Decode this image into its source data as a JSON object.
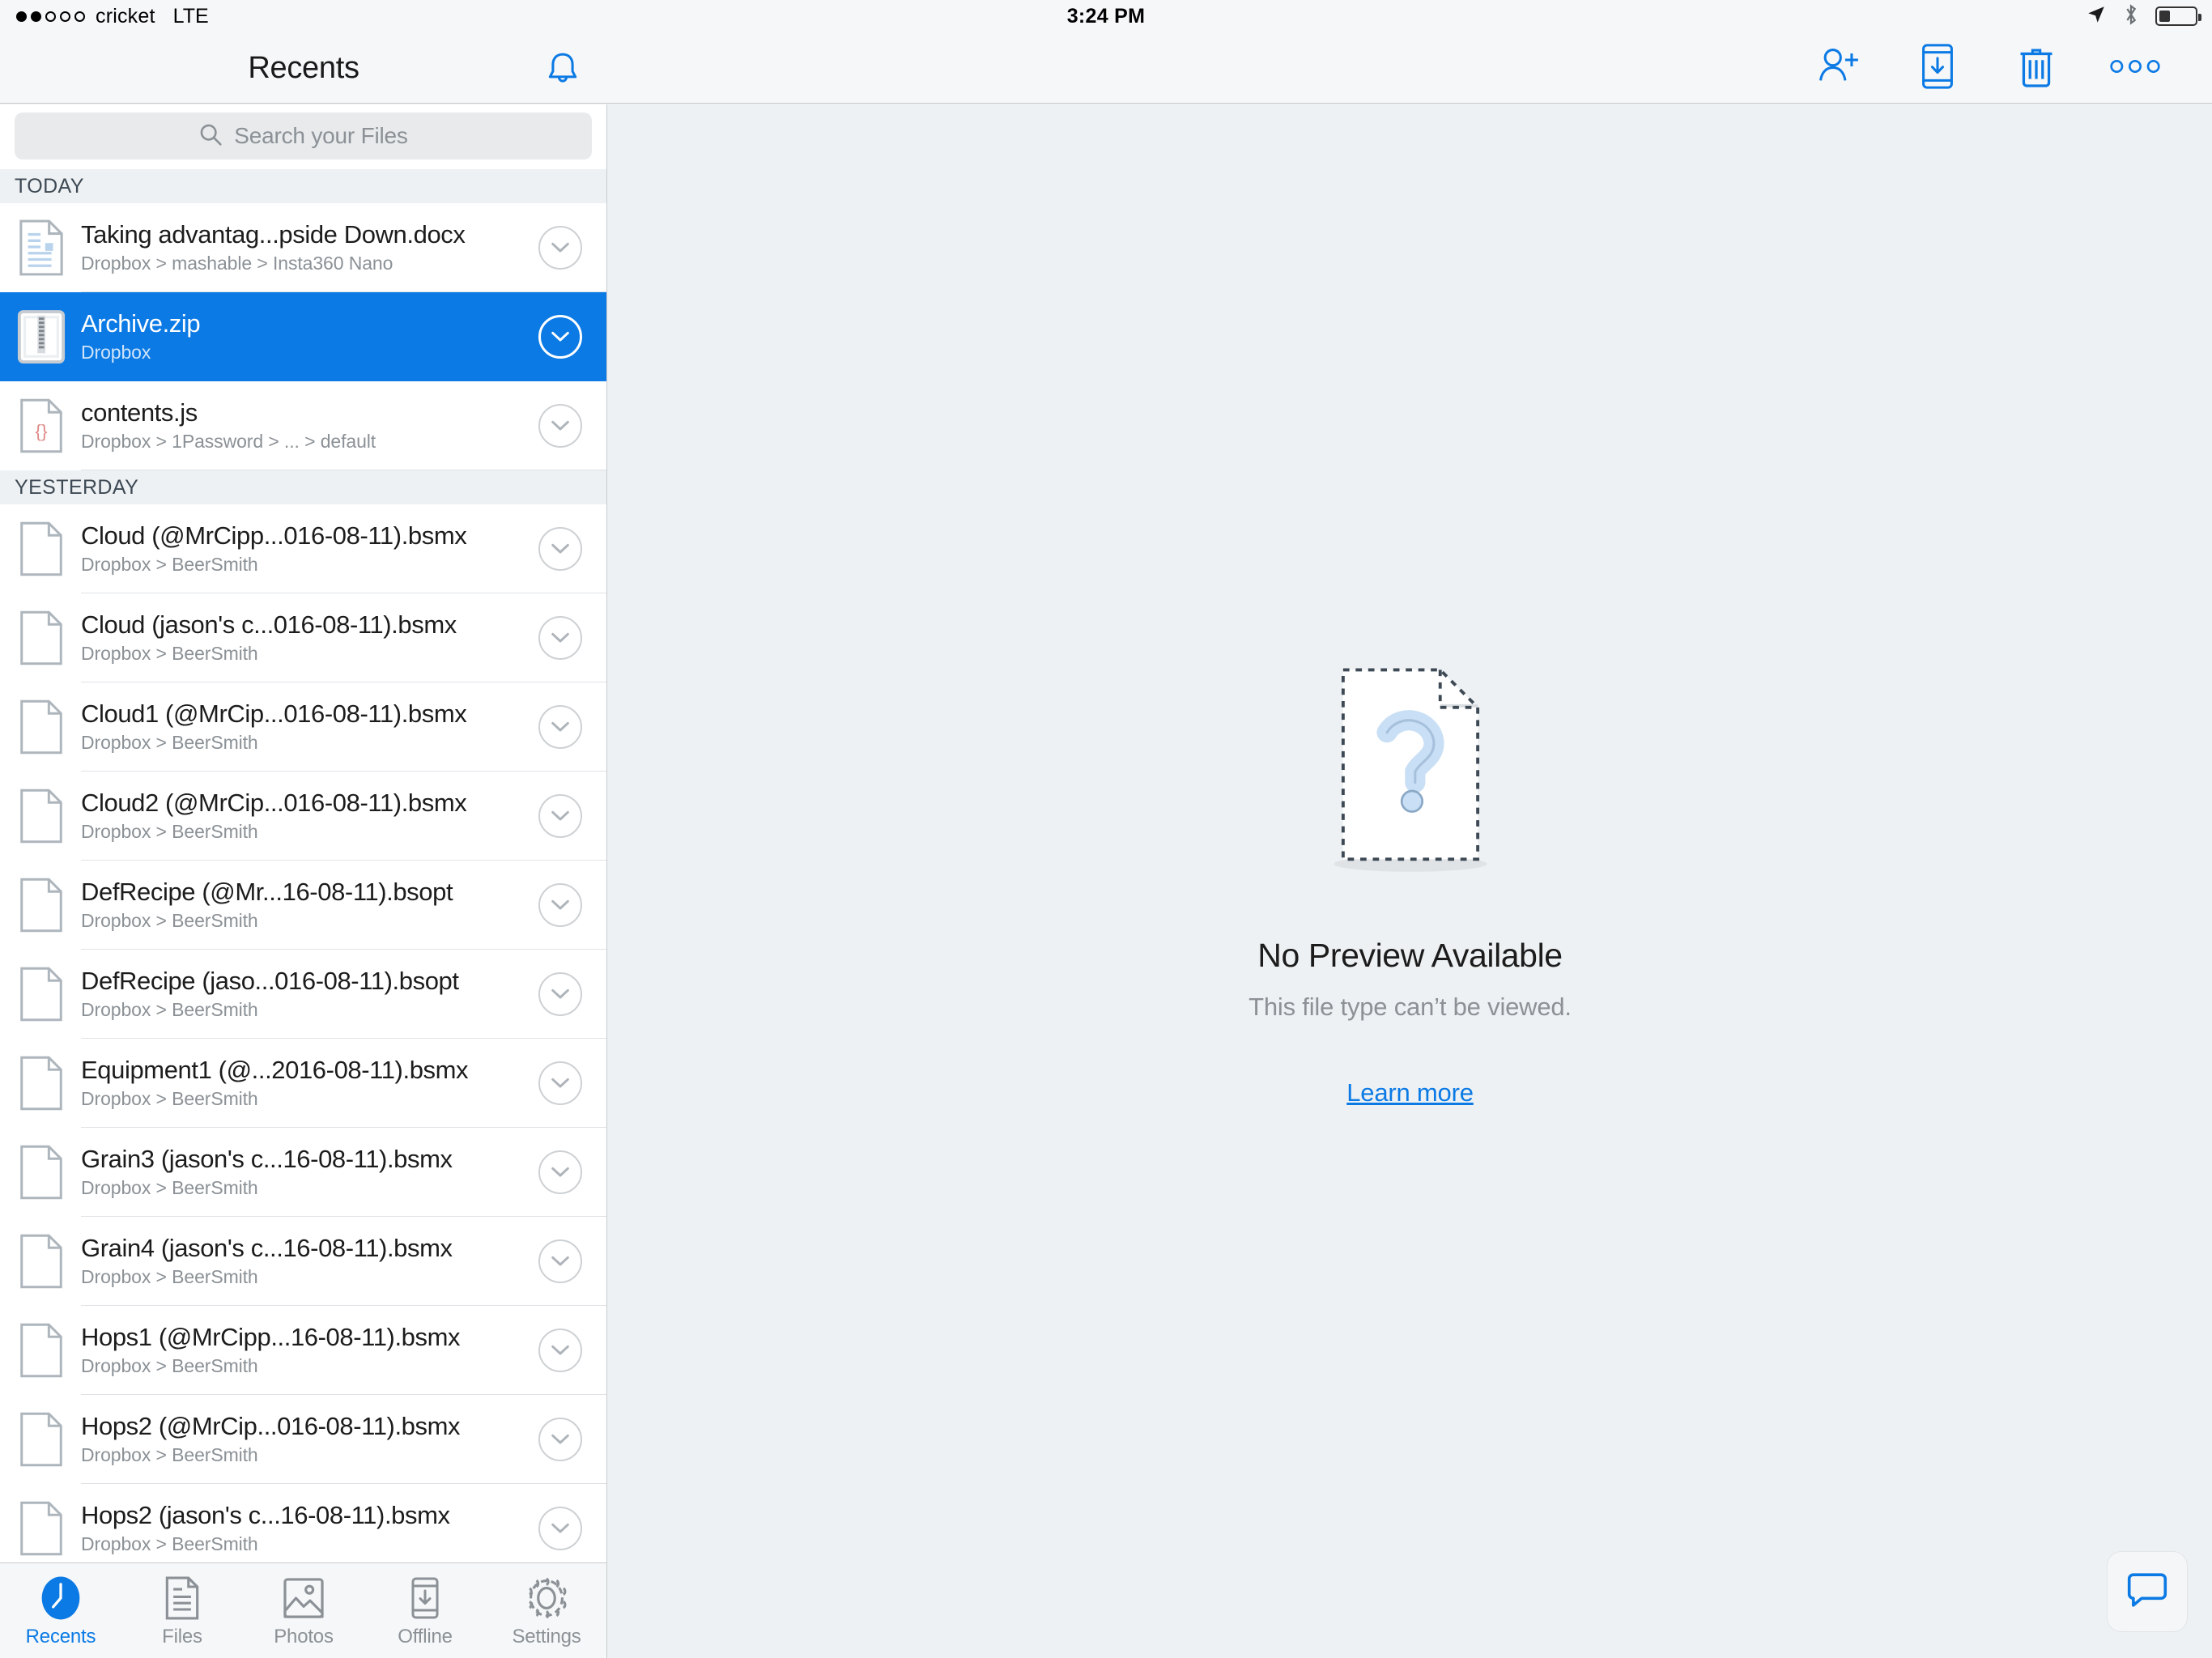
{
  "status_bar": {
    "signal_dots_total": 5,
    "signal_dots_filled": 2,
    "carrier": "cricket",
    "network": "LTE",
    "time": "3:24 PM",
    "battery_percent": 30,
    "icons": [
      "location-arrow-icon",
      "bluetooth-icon",
      "battery-icon"
    ]
  },
  "navbar": {
    "title": "Recents",
    "bell_icon": "bell-icon",
    "actions": [
      {
        "name": "share-add-person-button",
        "icon": "person-add-icon"
      },
      {
        "name": "save-to-device-button",
        "icon": "device-download-icon"
      },
      {
        "name": "delete-button",
        "icon": "trash-icon"
      },
      {
        "name": "more-options-button",
        "icon": "ellipsis-icon"
      }
    ]
  },
  "search": {
    "placeholder": "Search your Files",
    "icon": "search-icon",
    "value": ""
  },
  "sections": [
    {
      "header": "TODAY",
      "items": [
        {
          "name": "Taking advantag...pside Down.docx",
          "path": "Dropbox > mashable > Insta360 Nano",
          "icon": "doc-file-icon",
          "selected": false
        },
        {
          "name": "Archive.zip",
          "path": "Dropbox",
          "icon": "zip-file-icon",
          "selected": true
        },
        {
          "name": "contents.js",
          "path": "Dropbox > 1Password > ... > default",
          "icon": "js-file-icon",
          "selected": false
        }
      ]
    },
    {
      "header": "YESTERDAY",
      "items": [
        {
          "name": "Cloud (@MrCipp...016-08-11).bsmx",
          "path": "Dropbox > BeerSmith",
          "icon": "blank-file-icon",
          "selected": false
        },
        {
          "name": "Cloud (jason's c...016-08-11).bsmx",
          "path": "Dropbox > BeerSmith",
          "icon": "blank-file-icon",
          "selected": false
        },
        {
          "name": "Cloud1 (@MrCip...016-08-11).bsmx",
          "path": "Dropbox > BeerSmith",
          "icon": "blank-file-icon",
          "selected": false
        },
        {
          "name": "Cloud2 (@MrCip...016-08-11).bsmx",
          "path": "Dropbox > BeerSmith",
          "icon": "blank-file-icon",
          "selected": false
        },
        {
          "name": "DefRecipe (@Mr...16-08-11).bsopt",
          "path": "Dropbox > BeerSmith",
          "icon": "blank-file-icon",
          "selected": false
        },
        {
          "name": "DefRecipe (jaso...016-08-11).bsopt",
          "path": "Dropbox > BeerSmith",
          "icon": "blank-file-icon",
          "selected": false
        },
        {
          "name": "Equipment1 (@...2016-08-11).bsmx",
          "path": "Dropbox > BeerSmith",
          "icon": "blank-file-icon",
          "selected": false
        },
        {
          "name": "Grain3 (jason's c...16-08-11).bsmx",
          "path": "Dropbox > BeerSmith",
          "icon": "blank-file-icon",
          "selected": false
        },
        {
          "name": "Grain4 (jason's c...16-08-11).bsmx",
          "path": "Dropbox > BeerSmith",
          "icon": "blank-file-icon",
          "selected": false
        },
        {
          "name": "Hops1 (@MrCipp...16-08-11).bsmx",
          "path": "Dropbox > BeerSmith",
          "icon": "blank-file-icon",
          "selected": false
        },
        {
          "name": "Hops2 (@MrCip...016-08-11).bsmx",
          "path": "Dropbox > BeerSmith",
          "icon": "blank-file-icon",
          "selected": false
        },
        {
          "name": "Hops2 (jason's c...16-08-11).bsmx",
          "path": "Dropbox > BeerSmith",
          "icon": "blank-file-icon",
          "selected": false
        }
      ]
    }
  ],
  "tabbar": {
    "tabs": [
      {
        "label": "Recents",
        "icon": "clock-icon",
        "active": true
      },
      {
        "label": "Files",
        "icon": "document-icon",
        "active": false
      },
      {
        "label": "Photos",
        "icon": "photo-icon",
        "active": false
      },
      {
        "label": "Offline",
        "icon": "device-download-icon",
        "active": false
      },
      {
        "label": "Settings",
        "icon": "gear-icon",
        "active": false
      }
    ]
  },
  "preview": {
    "illustration": "no-preview-document-question-icon",
    "title": "No Preview Available",
    "subtitle": "This file type can’t be viewed.",
    "link": "Learn more"
  },
  "chat": {
    "icon": "chat-bubble-icon"
  },
  "colors": {
    "accent": "#0b7ae5",
    "selection": "#0b7ae5",
    "chrome": "#f6f7f8",
    "canvas": "#eef1f3",
    "section_header_bg": "#eef1f3",
    "muted_text": "#8b9196"
  }
}
